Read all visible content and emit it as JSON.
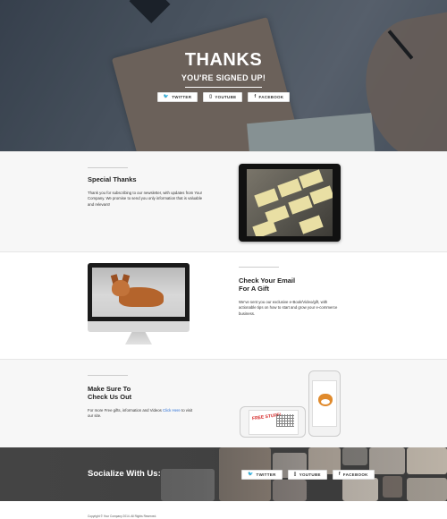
{
  "hero": {
    "title": "THANKS",
    "subtitle": "YOU'RE SIGNED UP!",
    "buttons": [
      {
        "icon": "twitter-icon",
        "label": "TWITTER"
      },
      {
        "icon": "youtube-icon",
        "label": "YOUTUBE"
      },
      {
        "icon": "facebook-icon",
        "label": "FACEBOOK"
      }
    ]
  },
  "section1": {
    "title": "Special Thanks",
    "text": "Thank you for subscribing to our newsletter, with updates from Your Company. We promise to send you only information that is valuable and relevant!"
  },
  "section2": {
    "title_line1": "Check Your Email",
    "title_line2": "For A Gift",
    "text": "We've sent you our exclusive e-Book/Video/gift, with actionable tips on how to start and grow your e-commerce business."
  },
  "section3": {
    "title_line1": "Make Sure To",
    "title_line2": "Check Us Out",
    "text_before": "For more Free gifts, information and Videos ",
    "link_label": "Click Here",
    "text_after": " to visit our site.",
    "phone_text": "FREE STUFF!"
  },
  "social": {
    "title": "Socialize With Us:",
    "buttons": [
      {
        "icon": "twitter-icon",
        "label": "TWITTER"
      },
      {
        "icon": "youtube-icon",
        "label": "YOUTUBE"
      },
      {
        "icon": "facebook-icon",
        "label": "FACEBOOK"
      }
    ]
  },
  "footer": {
    "copyright": "Copyright © Your Company 2014. All Rights Reserved."
  }
}
